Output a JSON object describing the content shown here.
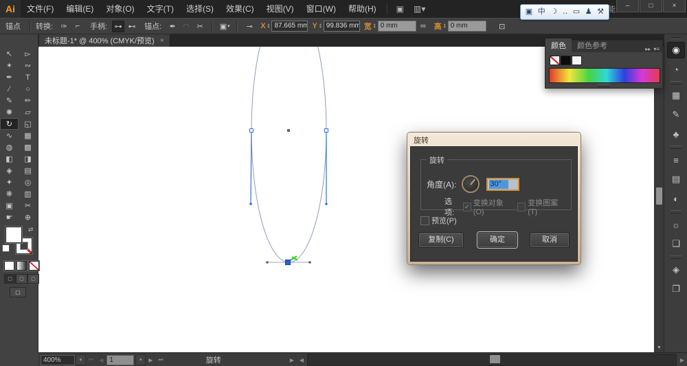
{
  "menubar": {
    "logo": "Ai",
    "items": [
      {
        "name": "file",
        "label": "文件(F)"
      },
      {
        "name": "edit",
        "label": "编辑(E)"
      },
      {
        "name": "object",
        "label": "对象(O)"
      },
      {
        "name": "type",
        "label": "文字(T)"
      },
      {
        "name": "select",
        "label": "选择(S)"
      },
      {
        "name": "effect",
        "label": "效果(C)"
      },
      {
        "name": "view",
        "label": "视图(V)"
      },
      {
        "name": "window",
        "label": "窗口(W)"
      },
      {
        "name": "help",
        "label": "帮助(H)"
      }
    ],
    "bridge_icon": "▣",
    "arrange_docs_icon": "▥▾",
    "workspace": "基本功能",
    "workspace_caret": "▾"
  },
  "window_controls": {
    "minimize": "–",
    "maximize": "□",
    "close": "×"
  },
  "ime_toolbar": {
    "icons": [
      {
        "name": "ime-logo-icon",
        "glyph": "▣"
      },
      {
        "name": "ime-chinese-mode-icon",
        "glyph": "中"
      },
      {
        "name": "ime-moon-icon",
        "glyph": "☽"
      },
      {
        "name": "ime-punctuation-icon",
        "glyph": "‥"
      },
      {
        "name": "ime-keyboard-icon",
        "glyph": "▭"
      },
      {
        "name": "ime-user-icon",
        "glyph": "♟"
      },
      {
        "name": "ime-wrench-icon",
        "glyph": "⚒"
      }
    ]
  },
  "controlbar": {
    "context_label": "锚点",
    "convert_label": "转换:",
    "convert_icons": [
      {
        "name": "convert-smooth-icon",
        "glyph": "✑"
      },
      {
        "name": "convert-corner-icon",
        "glyph": "⌐"
      }
    ],
    "handles_label": "手柄:",
    "handle_icons": [
      {
        "name": "show-handles-icon",
        "glyph": "⊶",
        "pressed": true
      },
      {
        "name": "hide-handles-icon",
        "glyph": "⊷",
        "pressed": false
      }
    ],
    "anchors_label": "锚点:",
    "anchor_icons": [
      {
        "name": "add-anchor-icon",
        "glyph": "✒"
      },
      {
        "name": "connect-path-icon",
        "glyph": "◠",
        "dim": true
      },
      {
        "name": "cut-path-icon",
        "glyph": "✂"
      }
    ],
    "isolate_icon": "▣",
    "isolate_caret": "▾",
    "dashdot_icon": "⊸",
    "fields": {
      "x": {
        "label": "X",
        "value": "87.665 mm"
      },
      "y": {
        "label": "Y",
        "value": "99.836 mm"
      },
      "w": {
        "label": "宽",
        "value": "0 mm"
      },
      "h": {
        "label": "高",
        "value": "0 mm"
      }
    },
    "link_icon": "∞",
    "transform_icon": "⊡"
  },
  "document_tab": {
    "title": "未标题-1* @ 400% (CMYK/预览)",
    "close_icon": "×",
    "collapse_icon": "«"
  },
  "toolbar": {
    "tools": [
      {
        "name": "selection-tool",
        "glyph": "↖"
      },
      {
        "name": "direct-selection-tool",
        "glyph": "▻"
      },
      {
        "name": "magic-wand-tool",
        "glyph": "✶"
      },
      {
        "name": "lasso-tool",
        "glyph": "∾"
      },
      {
        "name": "pen-tool",
        "glyph": "✒"
      },
      {
        "name": "type-tool",
        "glyph": "T"
      },
      {
        "name": "line-segment-tool",
        "glyph": "∕"
      },
      {
        "name": "ellipse-tool",
        "glyph": "○"
      },
      {
        "name": "paintbrush-tool",
        "glyph": "✎"
      },
      {
        "name": "pencil-tool",
        "glyph": "✏"
      },
      {
        "name": "blob-brush-tool",
        "glyph": "✺"
      },
      {
        "name": "eraser-tool",
        "glyph": "▱"
      },
      {
        "name": "rotate-tool",
        "glyph": "↻",
        "active": true
      },
      {
        "name": "scale-tool",
        "glyph": "◱"
      },
      {
        "name": "width-tool",
        "glyph": "∿"
      },
      {
        "name": "free-transform-tool",
        "glyph": "▦"
      },
      {
        "name": "shape-builder-tool",
        "glyph": "◍"
      },
      {
        "name": "perspective-grid-tool",
        "glyph": "▩"
      },
      {
        "name": "live-paint-bucket-tool",
        "glyph": "◧"
      },
      {
        "name": "live-paint-selection-tool",
        "glyph": "◨"
      },
      {
        "name": "mesh-tool",
        "glyph": "◈"
      },
      {
        "name": "gradient-tool",
        "glyph": "▤"
      },
      {
        "name": "eyedropper-tool",
        "glyph": "✦"
      },
      {
        "name": "blend-tool",
        "glyph": "◎"
      },
      {
        "name": "symbol-sprayer-tool",
        "glyph": "❋"
      },
      {
        "name": "column-graph-tool",
        "glyph": "▥"
      },
      {
        "name": "artboard-tool",
        "glyph": "▣"
      },
      {
        "name": "slice-tool",
        "glyph": "✂"
      },
      {
        "name": "hand-tool",
        "glyph": "☛"
      },
      {
        "name": "zoom-tool",
        "glyph": "⊕"
      }
    ]
  },
  "dialog": {
    "title": "旋转",
    "group_title": "旋转",
    "angle_label": "角度(A):",
    "angle_value": "30°",
    "options_label": "选项:",
    "option_object": {
      "label": "变换对象(O)",
      "checked": true,
      "check_glyph": "✓"
    },
    "option_pattern": {
      "label": "变换图案(T)",
      "checked": false
    },
    "preview_label": "预览(P)",
    "buttons": {
      "copy": "复制(C)",
      "ok": "确定",
      "cancel": "取消"
    }
  },
  "color_panel": {
    "tabs": [
      {
        "name": "tab-color",
        "label": "颜色",
        "active": true
      },
      {
        "name": "tab-color-guide",
        "label": "颜色参考",
        "active": false
      }
    ],
    "expand_icon": "▸▸",
    "menu_icon": "▾≡"
  },
  "dock": {
    "groups": [
      [
        {
          "name": "panel-color-icon",
          "glyph": "◉",
          "active": true
        },
        {
          "name": "panel-color-guide-icon",
          "glyph": "◔"
        }
      ],
      [
        {
          "name": "panel-swatches-icon",
          "glyph": "▦"
        },
        {
          "name": "panel-brushes-icon",
          "glyph": "✎"
        },
        {
          "name": "panel-symbols-icon",
          "glyph": "♣"
        }
      ],
      [
        {
          "name": "panel-stroke-icon",
          "glyph": "≡"
        },
        {
          "name": "panel-gradient-icon",
          "glyph": "▤"
        },
        {
          "name": "panel-transparency-icon",
          "glyph": "◐"
        }
      ],
      [
        {
          "name": "panel-appearance-icon",
          "glyph": "☼"
        },
        {
          "name": "panel-graphic-styles-icon",
          "glyph": "❏"
        }
      ],
      [
        {
          "name": "panel-layers-icon",
          "glyph": "◈"
        },
        {
          "name": "panel-artboards-icon",
          "glyph": "❐"
        }
      ]
    ]
  },
  "statusbar": {
    "zoom": "400%",
    "zoom_caret": "▾",
    "nav": {
      "first": "⏮",
      "prev": "◀",
      "next": "▶",
      "last": "⏭",
      "caret": "▾"
    },
    "artboard_value": "1",
    "status_text": "旋转",
    "split_arrow": "▶",
    "hscroll_left": "◀",
    "hscroll_right": "▶",
    "vscroll_down": "▼"
  },
  "canvas_colors": {
    "path_stroke": "#8f9bc0",
    "handle_blue": "#3a6cd4",
    "selected_anchor": "#2a5fd8",
    "annotation_green": "#4ad13f"
  }
}
